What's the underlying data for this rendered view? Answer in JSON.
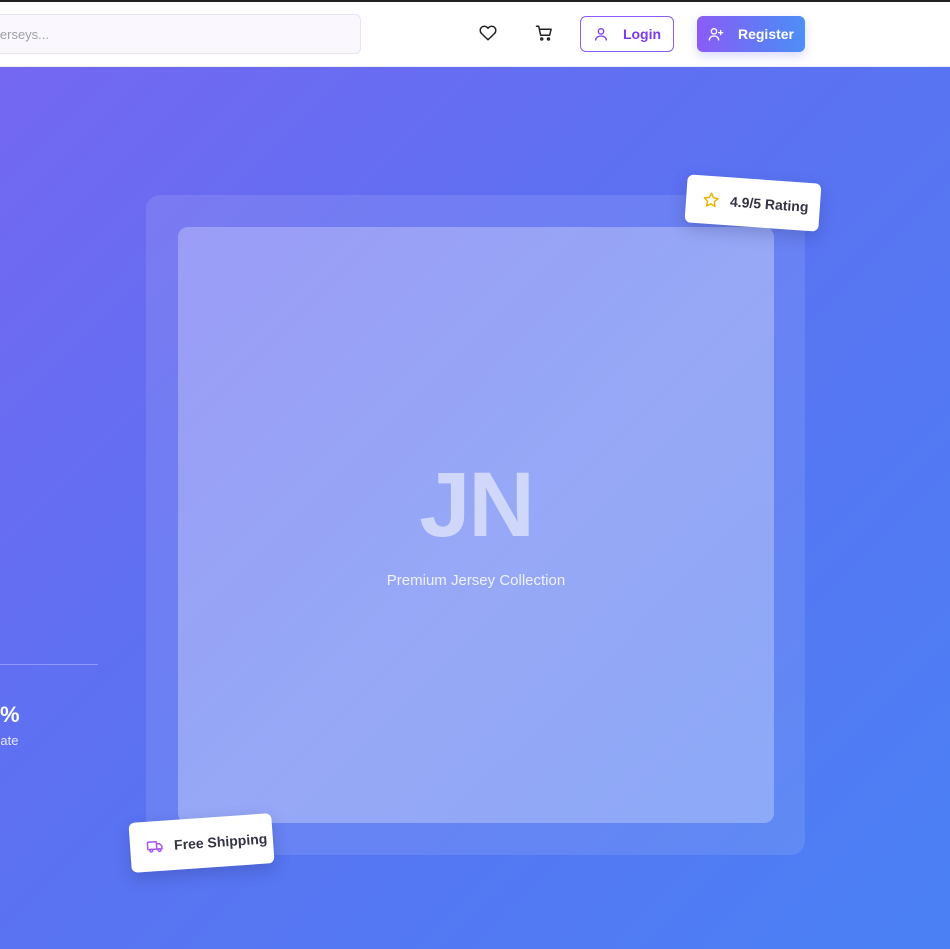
{
  "header": {
    "search": {
      "placeholder": "jerseys..."
    },
    "wishlist_icon": "heart-icon",
    "cart_icon": "cart-icon",
    "login_label": "Login",
    "register_label": "Register"
  },
  "hero": {
    "stat": {
      "value": "%",
      "label": "ion Rate"
    },
    "card": {
      "logo": "JN",
      "subtitle": "Premium Jersey Collection"
    },
    "badges": {
      "rating": "4.9/5 Rating",
      "shipping": "Free Shipping"
    }
  },
  "colors": {
    "accent": "#8b5cf6",
    "gradient_start": "#7467f1",
    "gradient_end": "#4a80f4",
    "star": "#eab308",
    "truck": "#a855f7"
  }
}
